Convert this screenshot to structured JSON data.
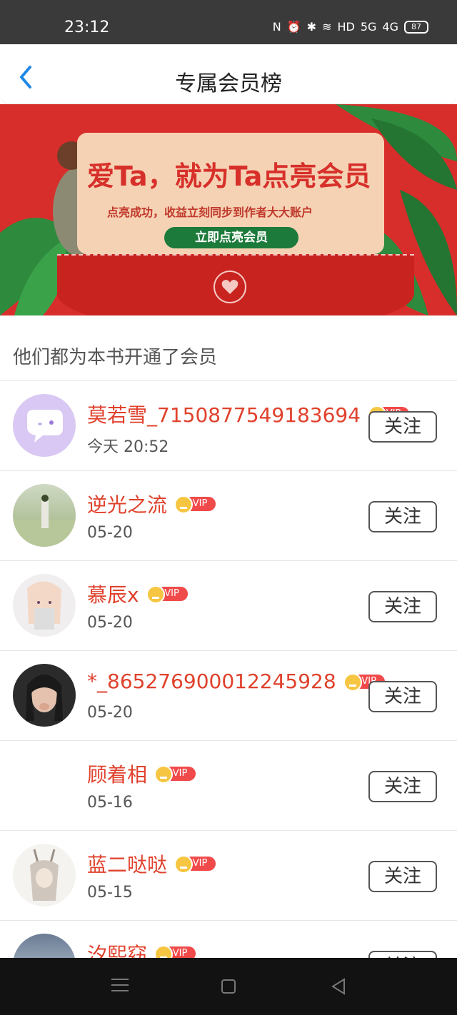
{
  "status_bar": {
    "time": "23:12",
    "icons": [
      "nfc-icon",
      "alarm-icon",
      "bluetooth-icon",
      "wifi-icon",
      "hd-icon",
      "5g-signal-icon",
      "4g-signal-icon"
    ],
    "hd_label": "HD",
    "net1": "5G",
    "net2": "4G",
    "battery": "87"
  },
  "header": {
    "title": "专属会员榜"
  },
  "banner": {
    "headline": "爱Ta，就为Ta点亮会员",
    "subline": "点亮成功，收益立刻同步到作者大大账户",
    "cta": "立即点亮会员"
  },
  "section": {
    "title": "他们都为本书开通了会员"
  },
  "members": [
    {
      "name": "莫若雪_7150877549183694",
      "time": "今天 20:52",
      "badge": "VIP",
      "follow": "关注"
    },
    {
      "name": "逆光之流",
      "time": "05-20",
      "badge": "VIP",
      "follow": "关注"
    },
    {
      "name": "慕辰x",
      "time": "05-20",
      "badge": "VIP",
      "follow": "关注"
    },
    {
      "name": "*_865276900012245928",
      "time": "05-20",
      "badge": "VIP",
      "follow": "关注"
    },
    {
      "name": "顾着相",
      "time": "05-16",
      "badge": "VIP",
      "follow": "关注"
    },
    {
      "name": "蓝二哒哒",
      "time": "05-15",
      "badge": "VIP",
      "follow": "关注"
    },
    {
      "name": "汐熙窈",
      "time": "",
      "badge": "VIP",
      "follow": "关注"
    }
  ],
  "colors": {
    "accent_red": "#e0412c",
    "banner_red": "#d72d2b",
    "vip_red": "#f04a4a",
    "crown_gold": "#f6c642",
    "back_blue": "#1e88e5"
  }
}
